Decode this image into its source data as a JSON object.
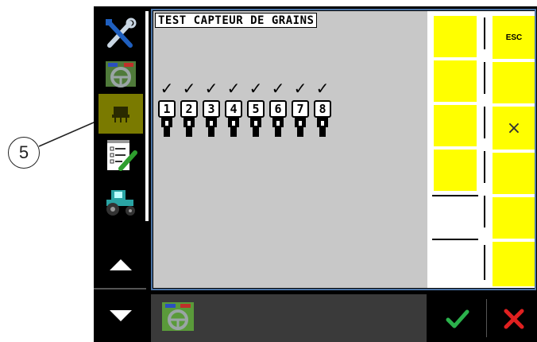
{
  "callout": {
    "label": "5"
  },
  "screen": {
    "title": "TEST CAPTEUR DE GRAINS",
    "sidebar": {
      "items": [
        {
          "icon": "settings-tools-icon"
        },
        {
          "icon": "steering-wheel-icon"
        },
        {
          "icon": "seed-drill-icon",
          "selected": true
        },
        {
          "icon": "checklist-icon"
        },
        {
          "icon": "tractor-icon"
        }
      ],
      "scroll_up_icon": "triangle-up-icon",
      "scroll_down_icon": "triangle-down-icon"
    },
    "sensors": [
      {
        "number": "1",
        "status": "✓"
      },
      {
        "number": "2",
        "status": "✓"
      },
      {
        "number": "3",
        "status": "✓"
      },
      {
        "number": "4",
        "status": "✓"
      },
      {
        "number": "5",
        "status": "✓"
      },
      {
        "number": "6",
        "status": "✓"
      },
      {
        "number": "7",
        "status": "✓"
      },
      {
        "number": "8",
        "status": "✓"
      }
    ],
    "softkeys": {
      "esc_label": "ESC",
      "cancel_symbol": "×"
    },
    "bottom_bar": {
      "icon": "steering-wheel-icon"
    },
    "confirm": {
      "ok_icon": "checkmark-icon",
      "cancel_icon": "red-x-icon"
    },
    "colors": {
      "softkey": "#ffff00",
      "selected": "#7a7a00",
      "ok": "#2bb24c",
      "cancel": "#e02020",
      "frame": "#4c74a6"
    }
  }
}
